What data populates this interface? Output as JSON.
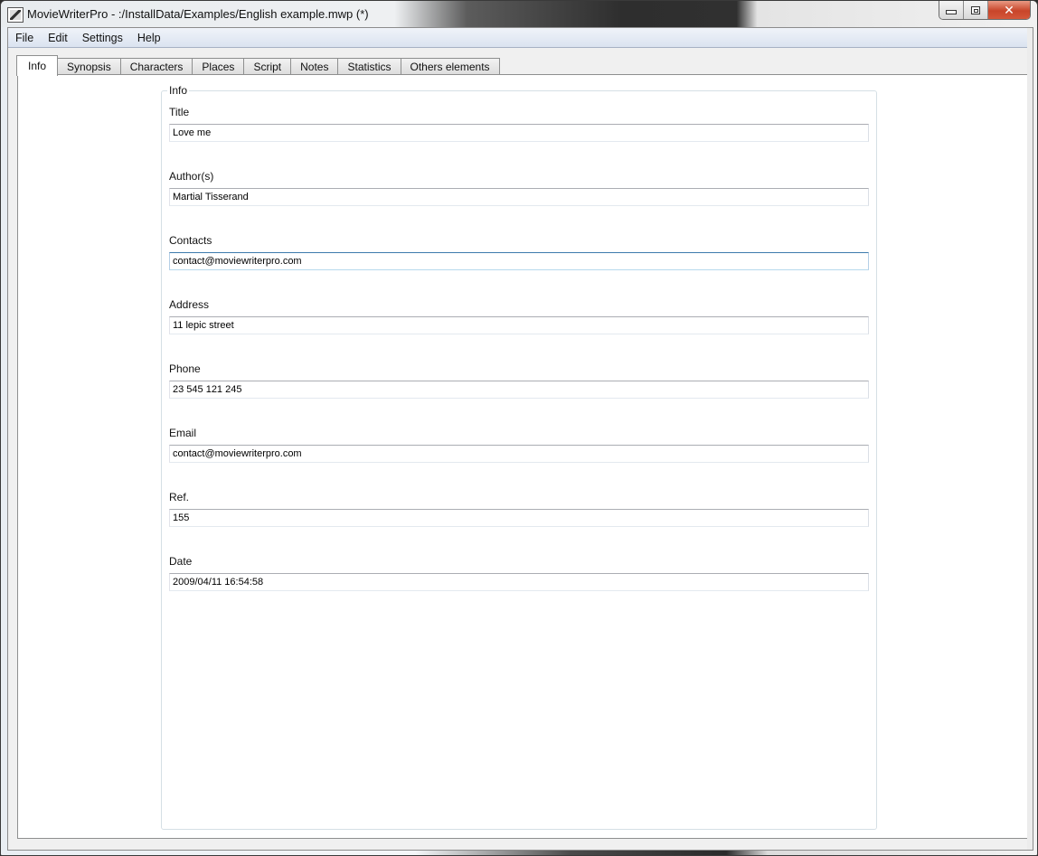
{
  "window": {
    "title": "MovieWriterPro - :/InstallData/Examples/English example.mwp (*)",
    "icon": "clapperboard-pen-icon",
    "caption_buttons": {
      "minimize": "minimize",
      "maximize": "maximize",
      "close": "✕"
    }
  },
  "menubar": {
    "items": [
      "File",
      "Edit",
      "Settings",
      "Help"
    ]
  },
  "tabs": {
    "active": "Info",
    "items": [
      "Info",
      "Synopsis",
      "Characters",
      "Places",
      "Script",
      "Notes",
      "Statistics",
      "Others elements"
    ]
  },
  "info_group": {
    "title": "Info",
    "fields": [
      {
        "label": "Title",
        "value": "Love me",
        "focused": false
      },
      {
        "label": "Author(s)",
        "value": "Martial Tisserand",
        "focused": false
      },
      {
        "label": "Contacts",
        "value": "contact@moviewriterpro.com",
        "focused": true
      },
      {
        "label": "Address",
        "value": "11 lepic street",
        "focused": false
      },
      {
        "label": "Phone",
        "value": "23 545 121 245",
        "focused": false
      },
      {
        "label": "Email",
        "value": "contact@moviewriterpro.com",
        "focused": false
      },
      {
        "label": "Ref.",
        "value": "155",
        "focused": false
      },
      {
        "label": "Date",
        "value": "2009/04/11 16:54:58",
        "focused": false
      }
    ]
  }
}
